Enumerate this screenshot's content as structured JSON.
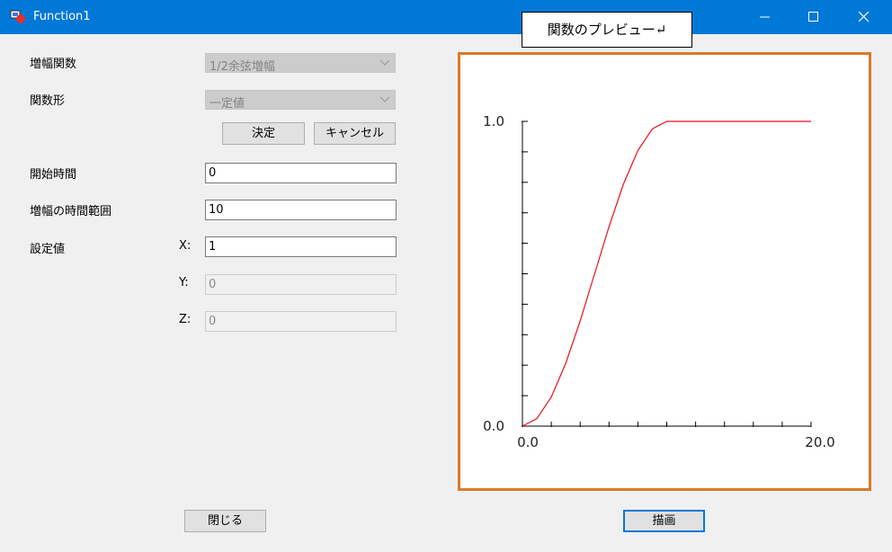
{
  "window": {
    "title": "Function1",
    "icon": "app-icon"
  },
  "form": {
    "amp_func_label": "増幅関数",
    "amp_func_value": "1/2余弦増幅",
    "func_shape_label": "関数形",
    "func_shape_value": "一定値",
    "ok_button": "決定",
    "cancel_button": "キャンセル",
    "start_time_label": "開始時間",
    "start_time_value": "0",
    "amp_range_label": "増幅の時間範囲",
    "amp_range_value": "10",
    "set_value_label": "設定値",
    "x_label": "X:",
    "x_value": "1",
    "y_label": "Y:",
    "y_value": "0",
    "z_label": "Z:",
    "z_value": "0",
    "close_button": "閉じる",
    "draw_button": "描画"
  },
  "caption": "関数のプレビュー↵",
  "chart_data": {
    "type": "line",
    "title": "",
    "xlabel": "",
    "ylabel": "",
    "xlim": [
      0,
      20
    ],
    "ylim": [
      0,
      1
    ],
    "x_tick_labels": [
      "0.0",
      "20.0"
    ],
    "y_tick_labels": [
      "0.0",
      "1.0"
    ],
    "series": [
      {
        "color": "#e8101a",
        "x": [
          0,
          1,
          2,
          3,
          4,
          5,
          6,
          7,
          8,
          9,
          10,
          12,
          14,
          16,
          18,
          20
        ],
        "y": [
          0,
          0.0245,
          0.0955,
          0.2061,
          0.3455,
          0.5,
          0.6545,
          0.7939,
          0.9045,
          0.9755,
          1,
          1,
          1,
          1,
          1,
          1
        ]
      }
    ],
    "colors": {
      "frame": "#d97a2b",
      "axis": "#000000",
      "line": "#e8101a"
    }
  }
}
